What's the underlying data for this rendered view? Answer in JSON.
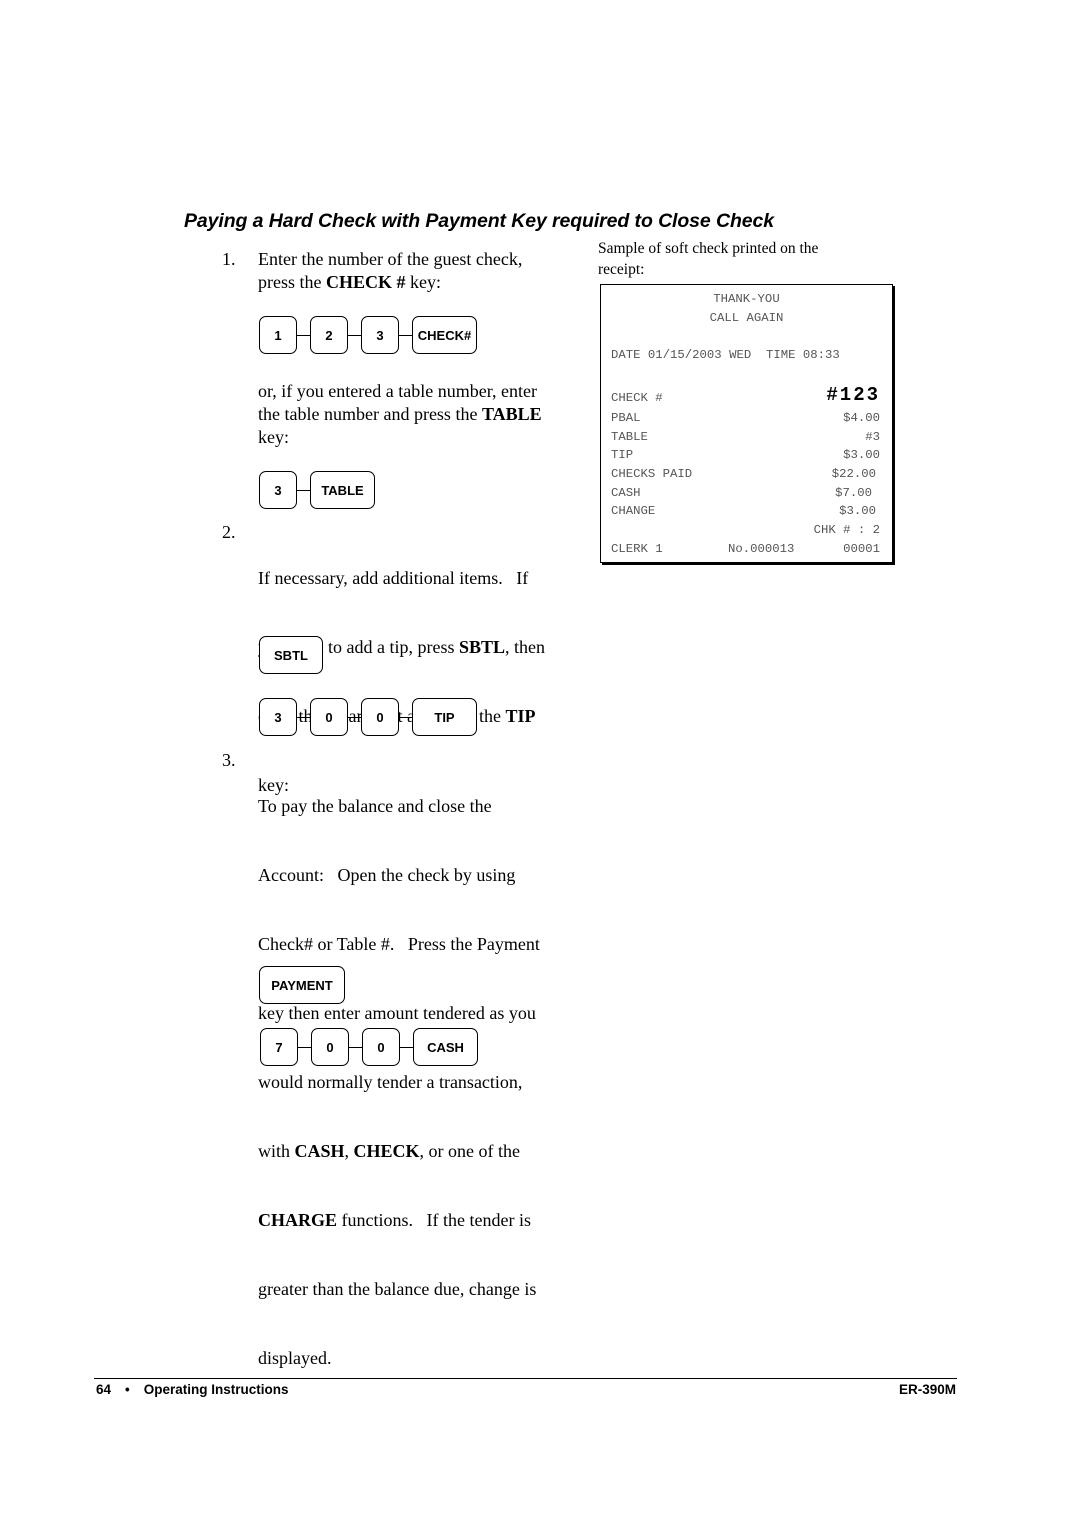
{
  "heading": "Paying a Hard Check with Payment Key required to Close Check",
  "steps": [
    {
      "number": "1.",
      "line1": "Enter the number of the guest check,",
      "line2_pre": "press the ",
      "line2_bold": "CHECK #",
      "line2_post": " key:"
    },
    {
      "number": "2.",
      "line1": "If necessary, add additional items.   If",
      "line2_pre": "you wish to add a tip, press ",
      "line2_bold": "SBTL",
      "line2_post": ", then",
      "line3_pre": "enter the tip amount and press the ",
      "line3_bold": "TIP",
      "line4": "key:"
    },
    {
      "number": "3.",
      "line1": "To pay the balance and close the",
      "line2": "Account:   Open the check by using",
      "line3": "Check# or Table #.   Press the Payment",
      "line4": "key then enter amount tendered as you",
      "line5": "would normally tender a transaction,",
      "line6_pre": "with ",
      "line6_bold1": "CASH",
      "line6_mid": ", ",
      "line6_bold2": "CHECK",
      "line6_post": ", or one of the",
      "line7_bold": "CHARGE",
      "line7_post": " functions.   If the tender is",
      "line8": "greater than the balance due, change is",
      "line9": "displayed."
    }
  ],
  "alt_paragraph": {
    "line1": "or, if you entered a table number, enter",
    "line2_pre": "the table number and press the ",
    "line2_bold": "TABLE",
    "line3": "key:"
  },
  "key_sequences": {
    "check": [
      "1",
      "2",
      "3",
      "CHECK#"
    ],
    "table": [
      "3",
      "TABLE"
    ],
    "sbtl": [
      "SBTL"
    ],
    "tip": [
      "3",
      "0",
      "0",
      "TIP"
    ],
    "payment": [
      "PAYMENT"
    ],
    "cash": [
      "7",
      "0",
      "0",
      "CASH"
    ]
  },
  "receipt": {
    "caption": "Sample of soft check printed on the receipt:",
    "header1": "THANK-YOU",
    "header2": "CALL AGAIN",
    "date_line": "DATE 01/15/2003 WED  TIME 08:33",
    "rows": [
      {
        "label": "CHECK #",
        "value": "#123"
      },
      {
        "label": "PBAL",
        "value": "$4.00"
      },
      {
        "label": "TABLE",
        "value": "#3"
      },
      {
        "label": "TIP",
        "value": "$3.00"
      },
      {
        "label": "CHECKS PAID",
        "value": "$22.00"
      },
      {
        "label": "CASH",
        "value": "$7.00"
      },
      {
        "label": "CHANGE",
        "value": "$3.00"
      },
      {
        "label": "",
        "value": "CHK # : 2"
      }
    ],
    "clerk": "CLERK 1",
    "number": "No.000013",
    "sequence": "00001"
  },
  "footer": {
    "page": "64",
    "bullet": "•",
    "section": "Operating Instructions",
    "model": "ER-390M"
  }
}
